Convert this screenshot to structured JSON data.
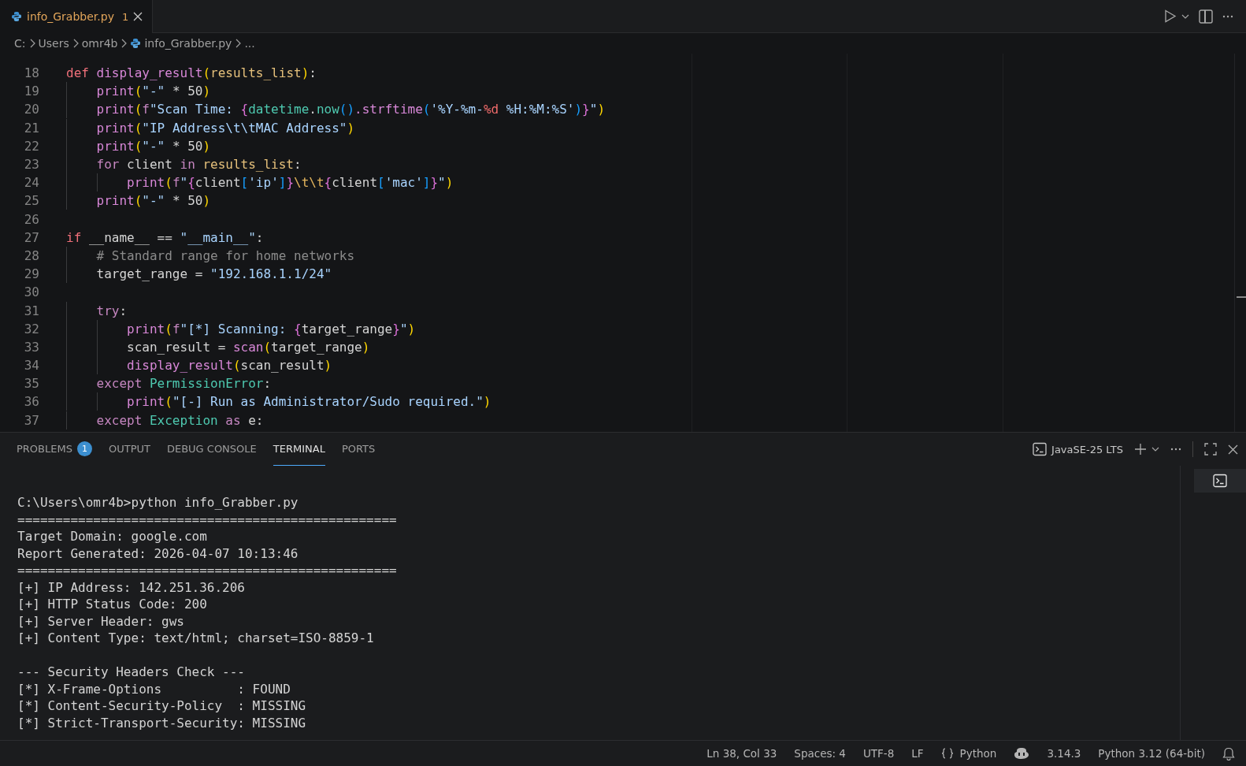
{
  "tabs": [
    {
      "label": "info_Grabber.py",
      "badge": "1",
      "selected": true
    }
  ],
  "breadcrumbs": [
    {
      "label": "C:",
      "kind": "folder"
    },
    {
      "label": "Users",
      "kind": "folder"
    },
    {
      "label": "omr4b",
      "kind": "folder"
    },
    {
      "label": "info_Grabber.py",
      "kind": "file"
    },
    {
      "label": "...",
      "kind": "more"
    }
  ],
  "editor": {
    "lines": [
      {
        "number": "18",
        "tokens": [
          {
            "text": "def",
            "kind": "kw1"
          },
          {
            "text": " display_result",
            "kind": "fn"
          },
          {
            "text": "(",
            "kind": "b1"
          },
          {
            "text": "results_list",
            "kind": "param"
          },
          {
            "text": ")",
            "kind": "b1"
          },
          {
            "text": ":",
            "kind": "plain"
          }
        ]
      },
      {
        "number": "19",
        "tokens": [
          {
            "text": "    print",
            "kind": "fn"
          },
          {
            "text": "(",
            "kind": "b1"
          },
          {
            "text": "\"-\"",
            "kind": "str"
          },
          {
            "text": " * 50",
            "kind": "plain"
          },
          {
            "text": ")",
            "kind": "b1"
          }
        ]
      },
      {
        "number": "20",
        "tokens": [
          {
            "text": "    print",
            "kind": "fn"
          },
          {
            "text": "(",
            "kind": "b1"
          },
          {
            "text": "f",
            "kind": "kw2"
          },
          {
            "text": "\"Scan Time: ",
            "kind": "str"
          },
          {
            "text": "{",
            "kind": "b2"
          },
          {
            "text": "datetime",
            "kind": "cls"
          },
          {
            "text": ".",
            "kind": "plain"
          },
          {
            "text": "now",
            "kind": "cls"
          },
          {
            "text": "()",
            "kind": "b3"
          },
          {
            "text": ".strftime",
            "kind": "fn"
          },
          {
            "text": "(",
            "kind": "b3"
          },
          {
            "text": "'%Y-%m-",
            "kind": "str"
          },
          {
            "text": "%d",
            "kind": "fmt"
          },
          {
            "text": " %H:%M:%S'",
            "kind": "str"
          },
          {
            "text": ")",
            "kind": "b3"
          },
          {
            "text": "}",
            "kind": "b2"
          },
          {
            "text": "\"",
            "kind": "str"
          },
          {
            "text": ")",
            "kind": "b1"
          }
        ]
      },
      {
        "number": "21",
        "tokens": [
          {
            "text": "    print",
            "kind": "fn"
          },
          {
            "text": "(",
            "kind": "b1"
          },
          {
            "text": "\"IP Address\\t\\tMAC Address\"",
            "kind": "str"
          },
          {
            "text": ")",
            "kind": "b1"
          }
        ]
      },
      {
        "number": "22",
        "tokens": [
          {
            "text": "    print",
            "kind": "fn"
          },
          {
            "text": "(",
            "kind": "b1"
          },
          {
            "text": "\"-\"",
            "kind": "str"
          },
          {
            "text": " * 50",
            "kind": "plain"
          },
          {
            "text": ")",
            "kind": "b1"
          }
        ]
      },
      {
        "number": "23",
        "tokens": [
          {
            "text": "    for",
            "kind": "kw2"
          },
          {
            "text": " client ",
            "kind": "plain"
          },
          {
            "text": "in",
            "kind": "kw2"
          },
          {
            "text": " results_list",
            "kind": "param"
          },
          {
            "text": ":",
            "kind": "plain"
          }
        ]
      },
      {
        "number": "24",
        "tokens": [
          {
            "text": "        print",
            "kind": "fn"
          },
          {
            "text": "(",
            "kind": "b1"
          },
          {
            "text": "f",
            "kind": "kw2"
          },
          {
            "text": "\"",
            "kind": "str"
          },
          {
            "text": "{",
            "kind": "b2"
          },
          {
            "text": "client",
            "kind": "plain"
          },
          {
            "text": "[",
            "kind": "b3"
          },
          {
            "text": "'ip'",
            "kind": "str"
          },
          {
            "text": "]",
            "kind": "b3"
          },
          {
            "text": "}",
            "kind": "b2"
          },
          {
            "text": "\\t\\t",
            "kind": "esc"
          },
          {
            "text": "{",
            "kind": "b2"
          },
          {
            "text": "client",
            "kind": "plain"
          },
          {
            "text": "[",
            "kind": "b3"
          },
          {
            "text": "'mac'",
            "kind": "str"
          },
          {
            "text": "]",
            "kind": "b3"
          },
          {
            "text": "}",
            "kind": "b2"
          },
          {
            "text": "\"",
            "kind": "str"
          },
          {
            "text": ")",
            "kind": "b1"
          }
        ]
      },
      {
        "number": "25",
        "tokens": [
          {
            "text": "    print",
            "kind": "fn"
          },
          {
            "text": "(",
            "kind": "b1"
          },
          {
            "text": "\"-\"",
            "kind": "str"
          },
          {
            "text": " * 50",
            "kind": "plain"
          },
          {
            "text": ")",
            "kind": "b1"
          }
        ]
      },
      {
        "number": "26"
      },
      {
        "number": "27",
        "tokens": [
          {
            "text": "if",
            "kind": "kw1"
          },
          {
            "text": " __name__ == ",
            "kind": "plain"
          },
          {
            "text": "\"__main__\"",
            "kind": "str"
          },
          {
            "text": ":",
            "kind": "plain"
          }
        ]
      },
      {
        "number": "28",
        "tokens": [
          {
            "text": "    # Standard range for home networks",
            "kind": "cmt"
          }
        ]
      },
      {
        "number": "29",
        "tokens": [
          {
            "text": "    target_range = ",
            "kind": "plain"
          },
          {
            "text": "\"192.168.1.1/24\"",
            "kind": "str"
          }
        ]
      },
      {
        "number": "30"
      },
      {
        "number": "31",
        "tokens": [
          {
            "text": "    try",
            "kind": "kw2"
          },
          {
            "text": ":",
            "kind": "plain"
          }
        ]
      },
      {
        "number": "32",
        "tokens": [
          {
            "text": "        print",
            "kind": "fn"
          },
          {
            "text": "(",
            "kind": "b1"
          },
          {
            "text": "f",
            "kind": "kw2"
          },
          {
            "text": "\"[*] Scanning: ",
            "kind": "str"
          },
          {
            "text": "{",
            "kind": "b2"
          },
          {
            "text": "target_range",
            "kind": "plain"
          },
          {
            "text": "}",
            "kind": "b2"
          },
          {
            "text": "\"",
            "kind": "str"
          },
          {
            "text": ")",
            "kind": "b1"
          }
        ]
      },
      {
        "number": "33",
        "tokens": [
          {
            "text": "        scan_result = ",
            "kind": "plain"
          },
          {
            "text": "scan",
            "kind": "fn"
          },
          {
            "text": "(",
            "kind": "b1"
          },
          {
            "text": "target_range",
            "kind": "plain"
          },
          {
            "text": ")",
            "kind": "b1"
          }
        ]
      },
      {
        "number": "34",
        "tokens": [
          {
            "text": "        display_result",
            "kind": "fn"
          },
          {
            "text": "(",
            "kind": "b1"
          },
          {
            "text": "scan_result",
            "kind": "plain"
          },
          {
            "text": ")",
            "kind": "b1"
          }
        ]
      },
      {
        "number": "35",
        "tokens": [
          {
            "text": "    except",
            "kind": "kw2"
          },
          {
            "text": " PermissionError",
            "kind": "cls"
          },
          {
            "text": ":",
            "kind": "plain"
          }
        ]
      },
      {
        "number": "36",
        "tokens": [
          {
            "text": "        print",
            "kind": "fn"
          },
          {
            "text": "(",
            "kind": "b1"
          },
          {
            "text": "\"[-] Run as Administrator/Sudo required.\"",
            "kind": "str"
          },
          {
            "text": ")",
            "kind": "b1"
          }
        ]
      },
      {
        "number": "37",
        "tokens": [
          {
            "text": "    except",
            "kind": "kw2"
          },
          {
            "text": " Exception",
            "kind": "cls"
          },
          {
            "text": " as",
            "kind": "kw2"
          },
          {
            "text": " e:",
            "kind": "plain"
          }
        ]
      }
    ]
  },
  "panel": {
    "tabs": [
      {
        "label": "PROBLEMS",
        "badge": "1",
        "selected": false
      },
      {
        "label": "OUTPUT",
        "selected": false
      },
      {
        "label": "DEBUG CONSOLE",
        "selected": false
      },
      {
        "label": "TERMINAL",
        "selected": true
      },
      {
        "label": "PORTS",
        "selected": false
      }
    ],
    "terminal_profile": "JavaSE-25 LTS",
    "terminal_blocks": [
      [
        "C:\\Users\\omr4b>python info_Grabber.py",
        "==================================================",
        "Target Domain: google.com",
        "Report Generated: 2026-04-07 10:13:46",
        "==================================================",
        "[+] IP Address: 142.251.36.206",
        "[+] HTTP Status Code: 200",
        "[+] Server Header: gws",
        "[+] Content Type: text/html; charset=ISO-8859-1"
      ],
      [
        "--- Security Headers Check ---",
        "[*] X-Frame-Options          : FOUND",
        "[*] Content-Security-Policy  : MISSING",
        "[*] Strict-Transport-Security: MISSING"
      ]
    ]
  },
  "status_bar": {
    "position": "Ln 38, Col 33",
    "indent": "Spaces: 4",
    "encoding": "UTF-8",
    "eol": "LF",
    "language": "Python",
    "version": "3.14.3",
    "interpreter": "Python 3.12 (64-bit)"
  }
}
